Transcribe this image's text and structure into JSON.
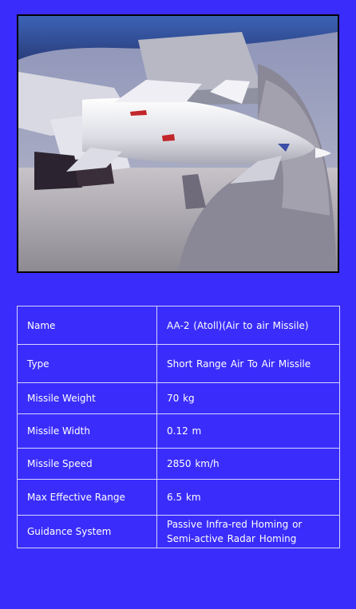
{
  "photo": {
    "subject": "air-to-air missile mounted under aircraft wing"
  },
  "specs": {
    "rows": [
      {
        "label": "Name",
        "value": "AA-2 (Atoll)(Air to air Missile)"
      },
      {
        "label": "Type",
        "value": "Short Range Air To Air Missile"
      },
      {
        "label": "Missile Weight",
        "value": "70 kg"
      },
      {
        "label": "Missile Width",
        "value": "0.12 m"
      },
      {
        "label": "Missile Speed",
        "value": "2850 km/h"
      },
      {
        "label": "Max Effective Range",
        "value": "6.5 km"
      },
      {
        "label": "Guidance System",
        "value": "Passive Infra-red Homing or Semi-active Radar Homing"
      }
    ]
  },
  "colors": {
    "background": "#3a2dfb",
    "border": "#d6d4ff",
    "text": "#ffffff"
  }
}
